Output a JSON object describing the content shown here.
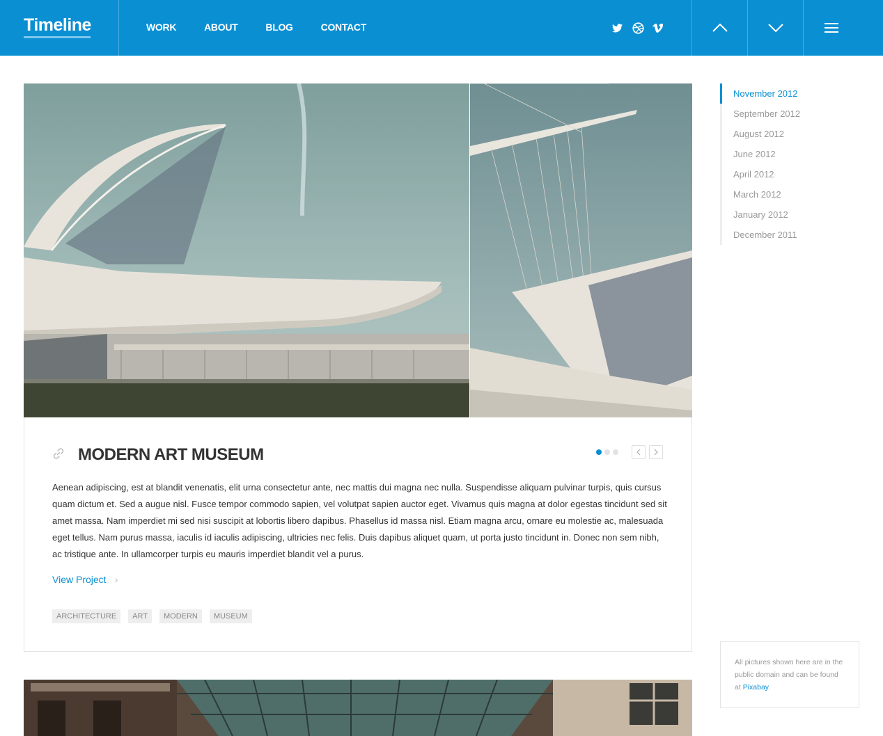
{
  "header": {
    "logo": "Timeline",
    "nav": [
      "WORK",
      "ABOUT",
      "BLOG",
      "CONTACT"
    ],
    "social_icons": [
      "twitter-icon",
      "dribbble-icon",
      "vimeo-icon"
    ],
    "buttons": [
      "chevron-up-icon",
      "chevron-down-icon",
      "menu-icon"
    ],
    "accent": "#0b8fd3"
  },
  "post": {
    "title": "MODERN ART MUSEUM",
    "body": "Aenean adipiscing, est at blandit venenatis, elit urna consectetur ante, nec mattis dui magna nec nulla. Suspendisse aliquam pulvinar turpis, quis cursus quam dictum et. Sed a augue nisl. Fusce tempor commodo sapien, vel volutpat sapien auctor eget. Vivamus quis magna at dolor egestas tincidunt sed sit amet massa. Nam imperdiet mi sed nisi suscipit at lobortis libero dapibus. Phasellus id massa nisl. Etiam magna arcu, ornare eu molestie ac, malesuada eget tellus. Nam purus massa, iaculis id iaculis adipiscing, ultricies nec felis. Duis dapibus aliquet quam, ut porta justo tincidunt in. Donec non sem nibh, ac tristique ante. In ullamcorper turpis eu mauris imperdiet blandit vel a purus.",
    "view_project": "View Project",
    "tags": [
      "ARCHITECTURE",
      "ART",
      "MODERN",
      "MUSEUM"
    ],
    "slider": {
      "slide_count": 3,
      "active_slide": 1
    }
  },
  "timeline": {
    "items": [
      "November 2012",
      "September 2012",
      "August 2012",
      "June 2012",
      "April 2012",
      "March 2012",
      "January 2012",
      "December 2011"
    ],
    "active": "November 2012"
  },
  "credits": {
    "text": "All pictures shown here are in the public domain and can be found at",
    "link": "Pixabay",
    "suffix": "."
  }
}
